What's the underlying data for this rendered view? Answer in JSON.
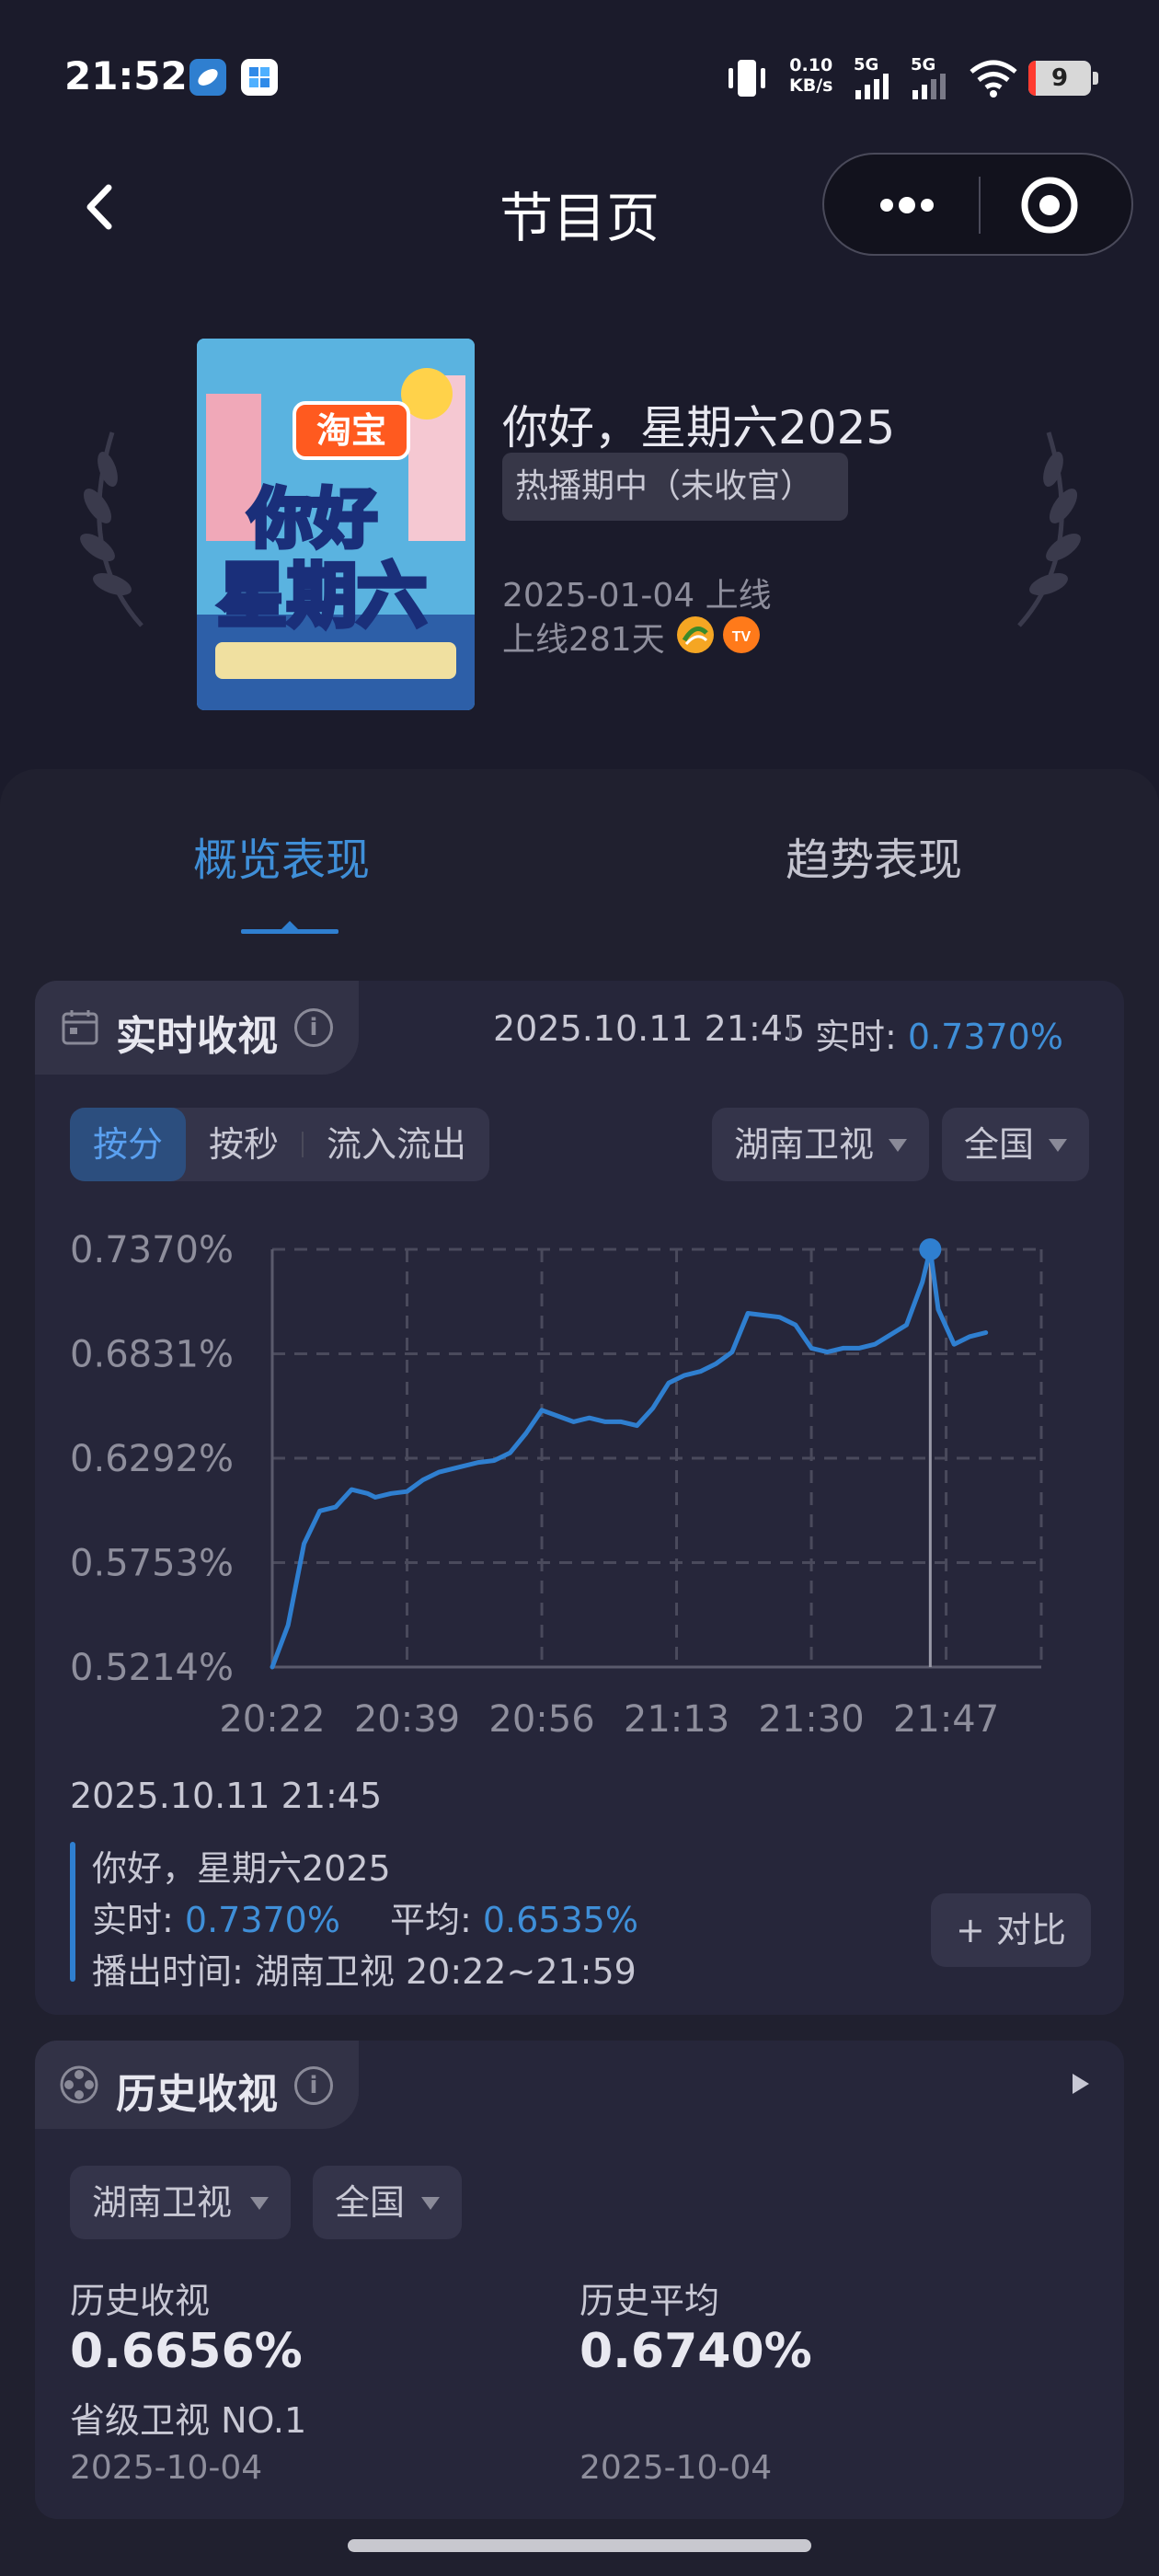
{
  "status_bar": {
    "time": "21:52",
    "net_speed_value": "0.10",
    "net_speed_unit": "KB/s",
    "sim1": "5G",
    "sim2": "5G",
    "battery": "9"
  },
  "nav": {
    "title": "节目页",
    "back_icon": "chevron-left-icon",
    "more_icon": "more-dots-icon",
    "target_icon": "target-icon"
  },
  "show": {
    "poster_logo": "淘宝",
    "poster_title_line1": "你好",
    "poster_title_line2": "星期六",
    "title": "你好，星期六2025",
    "status": "热播期中（未收官）",
    "launch_date": "2025-01-04 上线",
    "days_online": "上线281天"
  },
  "tabs": [
    {
      "label": "概览表现",
      "active": true
    },
    {
      "label": "趋势表现",
      "active": false
    }
  ],
  "realtime": {
    "title": "实时收视",
    "timestamp": "2025.10.11 21:45",
    "realtime_label": "实时: ",
    "realtime_value": "0.7370%",
    "segments": [
      "按分",
      "按秒",
      "流入流出"
    ],
    "active_segment": 0,
    "channel": "湖南卫视",
    "region": "全国"
  },
  "chart_data": {
    "type": "line",
    "title": "",
    "xlabel": "",
    "ylabel": "",
    "y_tick_labels": [
      "0.7370%",
      "0.6831%",
      "0.6292%",
      "0.5753%",
      "0.5214%"
    ],
    "x_tick_labels": [
      "20:22",
      "20:39",
      "20:56",
      "21:13",
      "21:30",
      "21:47"
    ],
    "ylim": [
      0.5214,
      0.737
    ],
    "x_minutes_range": [
      "20:22",
      "21:59"
    ],
    "grid": true,
    "series": [
      {
        "x": [
          "20:22",
          "20:24",
          "20:26",
          "20:28",
          "20:30",
          "20:32",
          "20:34",
          "20:35",
          "20:37",
          "20:39",
          "20:41",
          "20:43",
          "20:46",
          "20:48",
          "20:50",
          "20:52",
          "20:54",
          "20:56",
          "20:58",
          "21:00",
          "21:02",
          "21:04",
          "21:06",
          "21:08",
          "21:10",
          "21:12",
          "21:14",
          "21:16",
          "21:18",
          "21:20",
          "21:22",
          "21:24",
          "21:26",
          "21:28",
          "21:30",
          "21:32",
          "21:34",
          "21:36",
          "21:38",
          "21:40",
          "21:42",
          "21:44",
          "21:45",
          "21:46",
          "21:48",
          "21:50",
          "21:52"
        ],
        "values": [
          0.5214,
          0.543,
          0.585,
          0.602,
          0.604,
          0.613,
          0.611,
          0.609,
          0.611,
          0.612,
          0.618,
          0.622,
          0.625,
          0.627,
          0.628,
          0.632,
          0.642,
          0.654,
          0.651,
          0.648,
          0.65,
          0.648,
          0.648,
          0.646,
          0.655,
          0.668,
          0.672,
          0.674,
          0.678,
          0.684,
          0.704,
          0.703,
          0.702,
          0.698,
          0.686,
          0.684,
          0.686,
          0.686,
          0.688,
          0.693,
          0.698,
          0.72,
          0.737,
          0.706,
          0.688,
          0.692,
          0.694
        ],
        "color": "#2f7fd0"
      }
    ],
    "highlight": {
      "x": "21:45",
      "y": 0.737
    }
  },
  "summary": {
    "date": "2025.10.11 21:45",
    "show_name": "你好，星期六2025",
    "realtime_label": "实时: ",
    "realtime_value": "0.7370%",
    "average_label": "平均: ",
    "average_value": "0.6535%",
    "airtime_label": "播出时间: ",
    "airtime_value": "湖南卫视 20:22~21:59",
    "compare_button": "+ 对比"
  },
  "history": {
    "title": "历史收视",
    "channel": "湖南卫视",
    "region": "全国",
    "rating_label": "历史收视",
    "rating_value": "0.6656%",
    "rank": "省级卫视 NO.1",
    "rating_date": "2025-10-04",
    "average_label": "历史平均",
    "average_value": "0.6740%",
    "average_date": "2025-10-04"
  }
}
